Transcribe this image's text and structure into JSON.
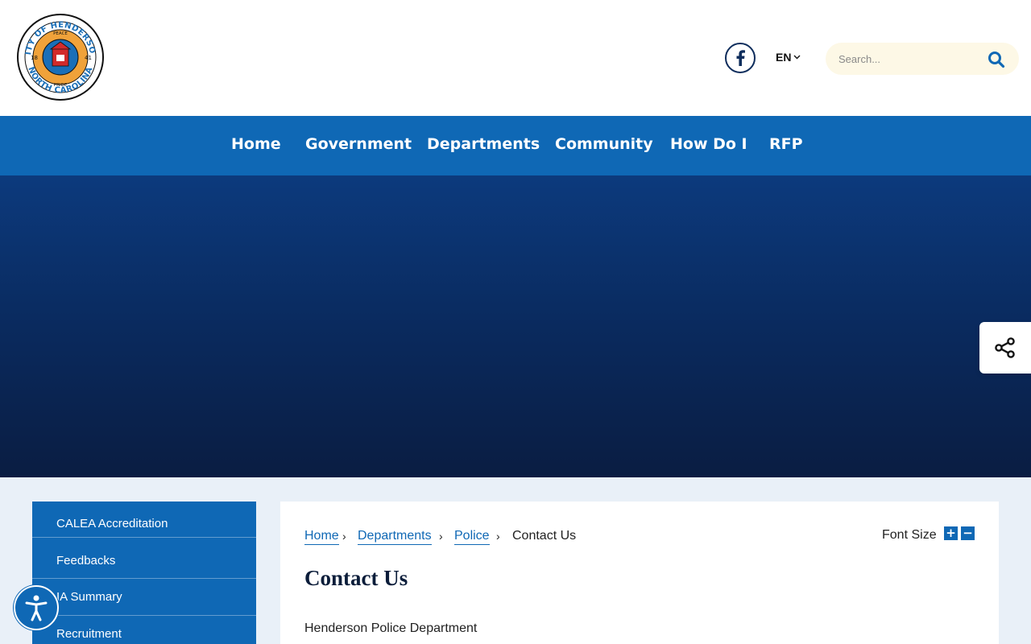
{
  "header": {
    "logo": {
      "icon": "city-seal-logo",
      "ring_text_top": "CITY OF HENDERSON",
      "ring_text_bottom": "NORTH CAROLINA",
      "mottos": [
        "PEACE",
        "PROGRESS",
        "PROSPERITY",
        "PRIDE"
      ],
      "year_left": "18",
      "year_right": "41"
    },
    "facebook_icon": "facebook-icon",
    "language": "EN",
    "search": {
      "placeholder": "Search..."
    }
  },
  "nav": {
    "items": [
      {
        "label": "Home"
      },
      {
        "label": "Government"
      },
      {
        "label": "Departments"
      },
      {
        "label": "Community"
      },
      {
        "label": "How Do I"
      },
      {
        "label": "RFP"
      }
    ]
  },
  "sidebar": {
    "items": [
      {
        "label": "CALEA Accreditation"
      },
      {
        "label": "Feedbacks"
      },
      {
        "label": "IA Summary"
      },
      {
        "label": "Recruitment"
      }
    ]
  },
  "breadcrumb": {
    "links": [
      "Home",
      "Departments",
      "Police"
    ],
    "current": "Contact Us"
  },
  "font_size": {
    "label": "Font Size",
    "increase": "+",
    "decrease": "−"
  },
  "page": {
    "title": "Contact Us",
    "first_line": "Henderson Police Department"
  },
  "colors": {
    "nav_blue": "#0f68b5",
    "hero_dark": "#0a1d42",
    "page_bg": "#e9f0f8",
    "search_bg": "#fdf8e6"
  }
}
